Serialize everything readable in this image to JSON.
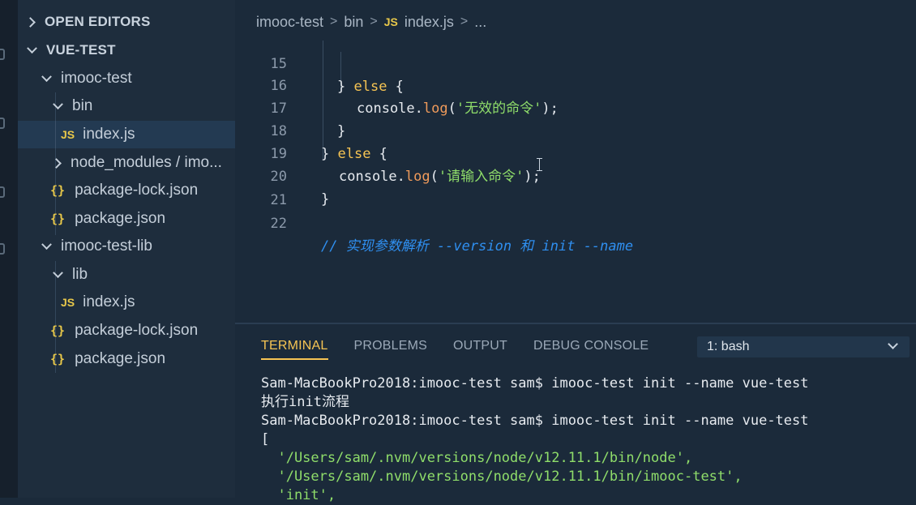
{
  "sidebar": {
    "open_editors": "OPEN EDITORS",
    "workspace": "VUE-TEST",
    "tree": [
      {
        "label": "imooc-test"
      },
      {
        "label": "bin"
      },
      {
        "label": "index.js"
      },
      {
        "label": "node_modules / imo..."
      },
      {
        "label": "package-lock.json"
      },
      {
        "label": "package.json"
      },
      {
        "label": "imooc-test-lib"
      },
      {
        "label": "lib"
      },
      {
        "label": "index.js"
      },
      {
        "label": "package-lock.json"
      },
      {
        "label": "package.json"
      }
    ],
    "js_icon_text": "JS",
    "json_icon_text": "{}"
  },
  "breadcrumb": {
    "items": [
      "imooc-test",
      "bin",
      "index.js",
      "..."
    ],
    "separator": ">",
    "js_icon_text": "JS"
  },
  "code": {
    "line_numbers": [
      "15",
      "16",
      "17",
      "18",
      "19",
      "20",
      "21",
      "22"
    ],
    "l15_brace": "} ",
    "l15_else": "else",
    "l15_open": " {",
    "l16_obj": "console.",
    "l16_fn": "log",
    "l16_open": "(",
    "l16_str": "'无效的命令'",
    "l16_close": ");",
    "l17": "}",
    "l18_brace": "} ",
    "l18_else": "else",
    "l18_open": " {",
    "l19_obj": "console.",
    "l19_fn": "log",
    "l19_open": "(",
    "l19_str": "'请输入命令'",
    "l19_close": ");",
    "l20": "}",
    "l22_comment": "// 实现参数解析 --version 和 init --name"
  },
  "panel": {
    "tabs": [
      "TERMINAL",
      "PROBLEMS",
      "OUTPUT",
      "DEBUG CONSOLE"
    ],
    "active_tab": "TERMINAL",
    "terminal_select": "1: bash",
    "lines": [
      "Sam-MacBookPro2018:imooc-test sam$ imooc-test init --name vue-test",
      "执行init流程",
      "Sam-MacBookPro2018:imooc-test sam$ imooc-test init --name vue-test",
      "[",
      "  '/Users/sam/.nvm/versions/node/v12.11.1/bin/node',",
      "  '/Users/sam/.nvm/versions/node/v12.11.1/bin/imooc-test',",
      "  'init',"
    ]
  },
  "colors": {
    "accent": "#f6c453",
    "string": "#8fdd6a",
    "comment": "#2f8ff0",
    "function": "#f09b5b",
    "background": "#1b2a3a"
  }
}
